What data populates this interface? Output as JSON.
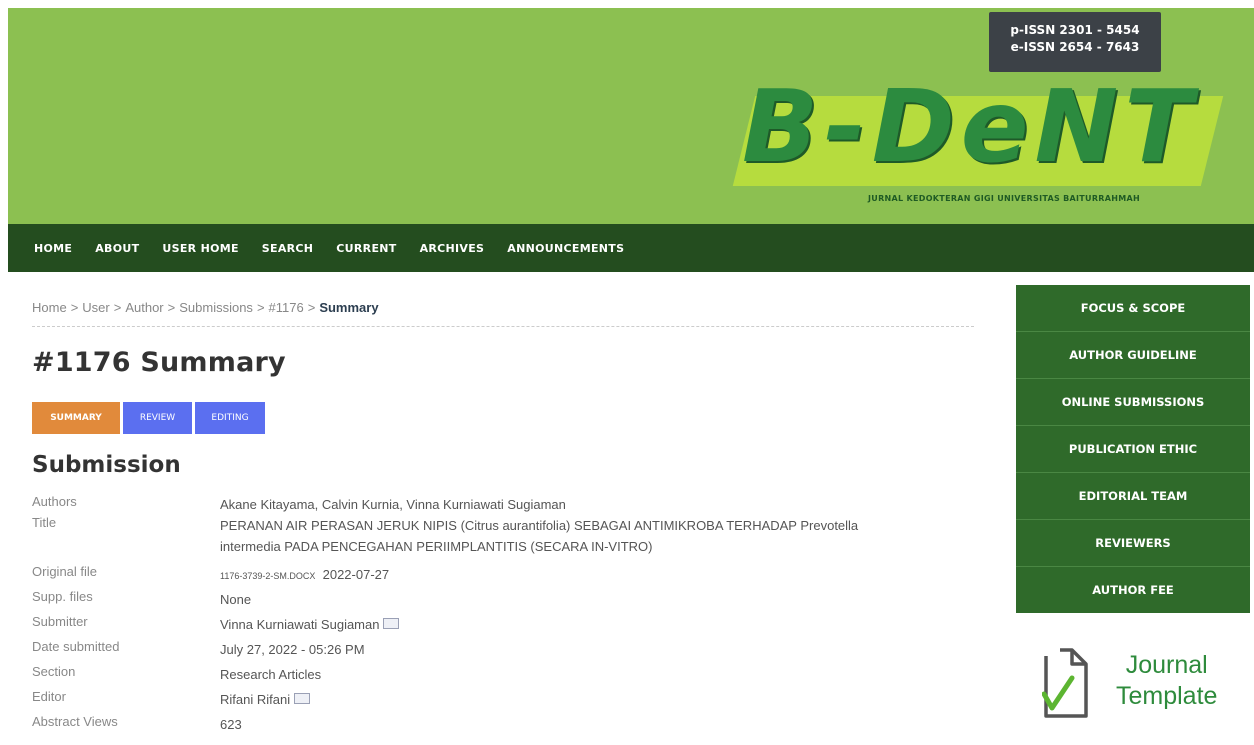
{
  "header": {
    "issn_print": "p-ISSN 2301 - 5454",
    "issn_online": "e-ISSN 2654 - 7643",
    "logo_text": "B-DeNT",
    "logo_subtitle": "JURNAL KEDOKTERAN GIGI UNIVERSITAS BAITURRAHMAH",
    "colors": {
      "banner": "#8cc051",
      "logo_band": "#b6dc3e",
      "logo_text": "#2c8b3f"
    }
  },
  "nav": {
    "items": [
      "HOME",
      "ABOUT",
      "USER HOME",
      "SEARCH",
      "CURRENT",
      "ARCHIVES",
      "ANNOUNCEMENTS"
    ],
    "color": "#244d1f"
  },
  "breadcrumb": {
    "items": [
      "Home",
      "User",
      "Author",
      "Submissions",
      "#1176"
    ],
    "current": "Summary"
  },
  "page": {
    "title": "#1176 Summary",
    "tabs": [
      "SUMMARY",
      "REVIEW",
      "EDITING"
    ],
    "active_tab": "SUMMARY",
    "section_title": "Submission"
  },
  "submission": {
    "authors_label": "Authors",
    "authors": "Akane Kitayama, Calvin Kurnia, Vinna Kurniawati Sugiaman",
    "title_label": "Title",
    "title_line1": "PERANAN AIR PERASAN JERUK NIPIS (Citrus aurantifolia) SEBAGAI ANTIMIKROBA TERHADAP Prevotella",
    "title_line2": "intermedia PADA PENCEGAHAN PERIIMPLANTITIS (SECARA IN-VITRO)",
    "original_file_label": "Original file",
    "original_file_name": "1176-3739-2-SM.DOCX",
    "original_file_date": "2022-07-27",
    "supp_files_label": "Supp. files",
    "supp_files": "None",
    "submitter_label": "Submitter",
    "submitter": "Vinna Kurniawati Sugiaman",
    "date_submitted_label": "Date submitted",
    "date_submitted": "July 27, 2022 - 05:26 PM",
    "section_label": "Section",
    "section": "Research Articles",
    "editor_label": "Editor",
    "editor": "Rifani Rifani",
    "abstract_views_label": "Abstract Views",
    "abstract_views": "623"
  },
  "sidebar": {
    "items": [
      "FOCUS & SCOPE",
      "AUTHOR GUIDELINE",
      "ONLINE SUBMISSIONS",
      "PUBLICATION ETHIC",
      "EDITORIAL TEAM",
      "REVIEWERS",
      "AUTHOR FEE"
    ],
    "color": "#2f6a2a"
  },
  "journal_template": {
    "line1": "Journal",
    "line2": "Template",
    "icon": "document-check-icon"
  }
}
